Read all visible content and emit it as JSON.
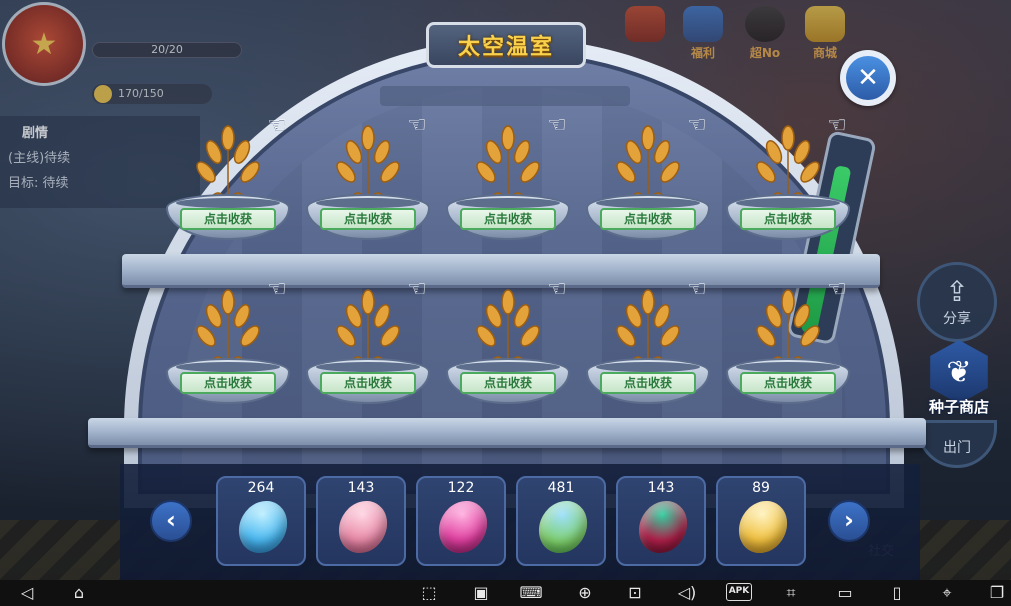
{
  "hud": {
    "hp_text": "20/20",
    "coin_text": "170/150",
    "task_header": "剧情",
    "task_line1": "(主线)待续",
    "task_line2": "目标: 待续",
    "top_icons": [
      "",
      "福利",
      "超No",
      "商城"
    ]
  },
  "greenhouse": {
    "title": "太空温室",
    "harvest_label": "点击收获",
    "top_row": [
      "点击收获",
      "点击收获",
      "点击收获",
      "点击收获",
      "点击收获"
    ],
    "bottom_row": [
      "点击收获",
      "点击收获",
      "点击收获",
      "点击收获",
      "点击收获"
    ],
    "crop_icon": "wheat-icon",
    "hint_icon": "white-glove-icon"
  },
  "seeds": [
    {
      "count": "264",
      "color": "#4bb8f0"
    },
    {
      "count": "143",
      "color": "#e88aa8"
    },
    {
      "count": "122",
      "color": "#e040a0"
    },
    {
      "count": "481",
      "color": "#7ed06a"
    },
    {
      "count": "143",
      "color": "#b0204a"
    },
    {
      "count": "89",
      "color": "#f0c040"
    }
  ],
  "side": {
    "share_label": "分享",
    "shop_label": "种子商店",
    "exit_label": "出门",
    "social_label": "社交"
  },
  "colors": {
    "title_gold": "#f9d14a",
    "harvest_green": "#4caa5f",
    "accent_blue": "#3d72c7"
  }
}
